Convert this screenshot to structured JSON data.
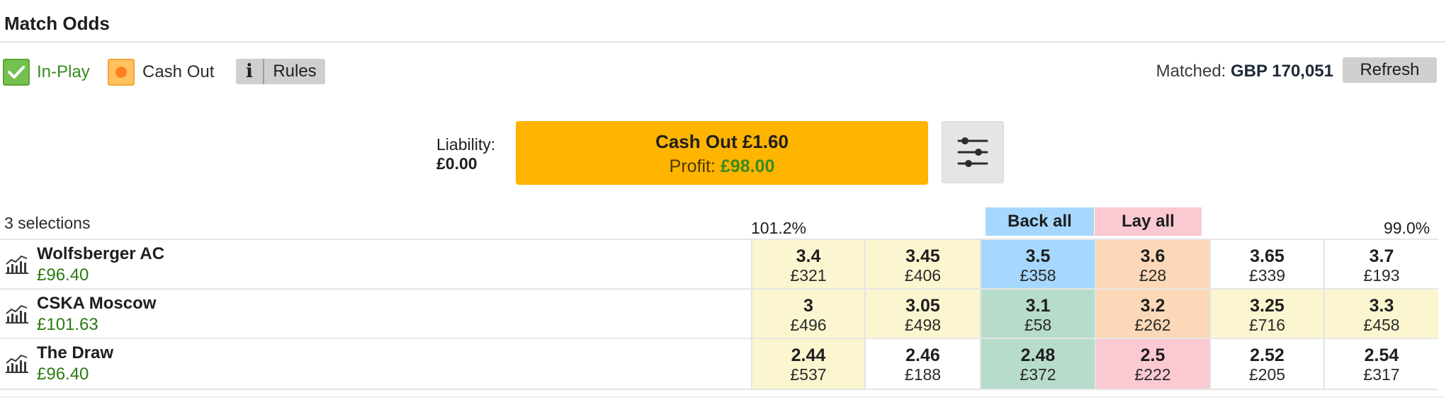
{
  "market": {
    "title": "Match Odds",
    "badges": {
      "in_play": "In-Play",
      "cash_out": "Cash Out",
      "rules": "Rules",
      "rules_icon": "i"
    },
    "matched": {
      "label": "Matched:",
      "value": "GBP 170,051"
    },
    "refresh_label": "Refresh"
  },
  "cashout": {
    "liability_label": "Liability:",
    "liability_value": "£0.00",
    "button_label": "Cash Out £1.60",
    "profit_label": "Profit:",
    "profit_value": "£98.00"
  },
  "grid": {
    "selections_label": "3 selections",
    "back_percent": "101.2%",
    "lay_percent": "99.0%",
    "back_all": "Back all",
    "lay_all": "Lay all"
  },
  "colors": {
    "back_best": "#a6d8ff",
    "back_best_suspended": "#b7dccb",
    "lay_best": "#fcd8b8",
    "lay_best_alt": "#fac9d1",
    "depth_back": "#fcf6d0",
    "depth_lay": "#fcf6d0",
    "neutral": "#ffffff",
    "profit_green": "#2c7a12",
    "cashout_yellow": "#ffb400"
  },
  "runners": [
    {
      "name": "Wolfsberger AC",
      "pl": "£96.40",
      "icon": "chart-icon",
      "cells": [
        {
          "price": "3.4",
          "size": "£321",
          "bg": "#fcf6d0"
        },
        {
          "price": "3.45",
          "size": "£406",
          "bg": "#fcf6d0"
        },
        {
          "price": "3.5",
          "size": "£358",
          "bg": "#a6d8ff"
        },
        {
          "price": "3.6",
          "size": "£28",
          "bg": "#fcd8b8"
        },
        {
          "price": "3.65",
          "size": "£339",
          "bg": "#ffffff"
        },
        {
          "price": "3.7",
          "size": "£193",
          "bg": "#ffffff"
        }
      ]
    },
    {
      "name": "CSKA Moscow",
      "pl": "£101.63",
      "icon": "chart-icon",
      "cells": [
        {
          "price": "3",
          "size": "£496",
          "bg": "#fcf6d0"
        },
        {
          "price": "3.05",
          "size": "£498",
          "bg": "#fcf6d0"
        },
        {
          "price": "3.1",
          "size": "£58",
          "bg": "#b7dccb"
        },
        {
          "price": "3.2",
          "size": "£262",
          "bg": "#fcd8b8"
        },
        {
          "price": "3.25",
          "size": "£716",
          "bg": "#fcf6d0"
        },
        {
          "price": "3.3",
          "size": "£458",
          "bg": "#fcf6d0"
        }
      ]
    },
    {
      "name": "The Draw",
      "pl": "£96.40",
      "icon": "chart-icon",
      "cells": [
        {
          "price": "2.44",
          "size": "£537",
          "bg": "#fcf6d0"
        },
        {
          "price": "2.46",
          "size": "£188",
          "bg": "#ffffff"
        },
        {
          "price": "2.48",
          "size": "£372",
          "bg": "#b7dccb"
        },
        {
          "price": "2.5",
          "size": "£222",
          "bg": "#fac9d1"
        },
        {
          "price": "2.52",
          "size": "£205",
          "bg": "#ffffff"
        },
        {
          "price": "2.54",
          "size": "£317",
          "bg": "#ffffff"
        }
      ]
    }
  ]
}
